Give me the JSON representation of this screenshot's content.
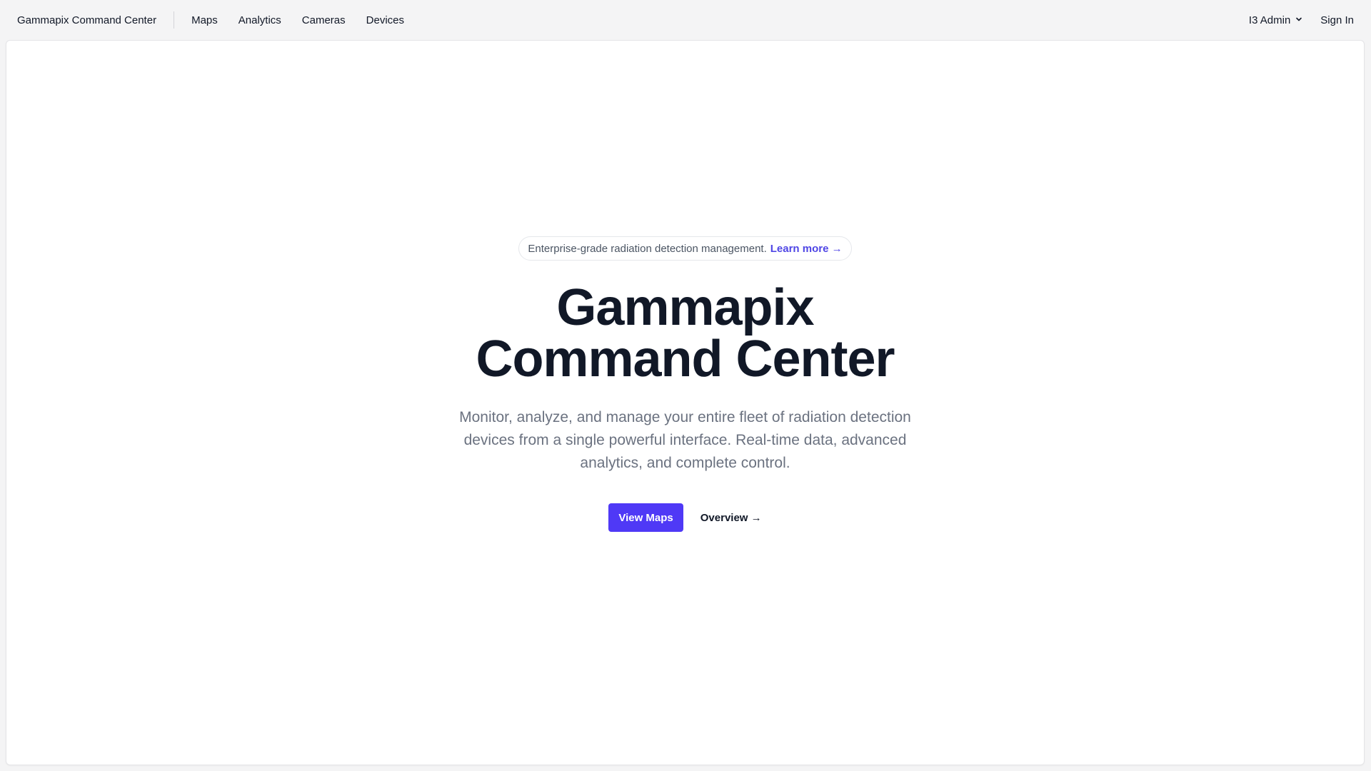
{
  "header": {
    "brand": "Gammapix Command Center",
    "nav": [
      {
        "label": "Maps"
      },
      {
        "label": "Analytics"
      },
      {
        "label": "Cameras"
      },
      {
        "label": "Devices"
      }
    ],
    "user_menu_label": "I3 Admin",
    "sign_in_label": "Sign In"
  },
  "hero": {
    "announcement_text": "Enterprise-grade radiation detection management.",
    "announcement_link": "Learn more →",
    "title_line1": "Gammapix",
    "title_line2": "Command Center",
    "subtitle": "Monitor, analyze, and manage your entire fleet of radiation detection devices from a single powerful interface. Real-time data, advanced analytics, and complete control.",
    "primary_button": "View Maps",
    "secondary_link": "Overview →"
  },
  "colors": {
    "accent": "#4f39f6",
    "link": "#4f46e5",
    "heading": "#111827",
    "muted": "#6b7280",
    "page_bg": "#f4f4f5"
  },
  "icons": {
    "user_menu": "chevron-down-icon"
  }
}
